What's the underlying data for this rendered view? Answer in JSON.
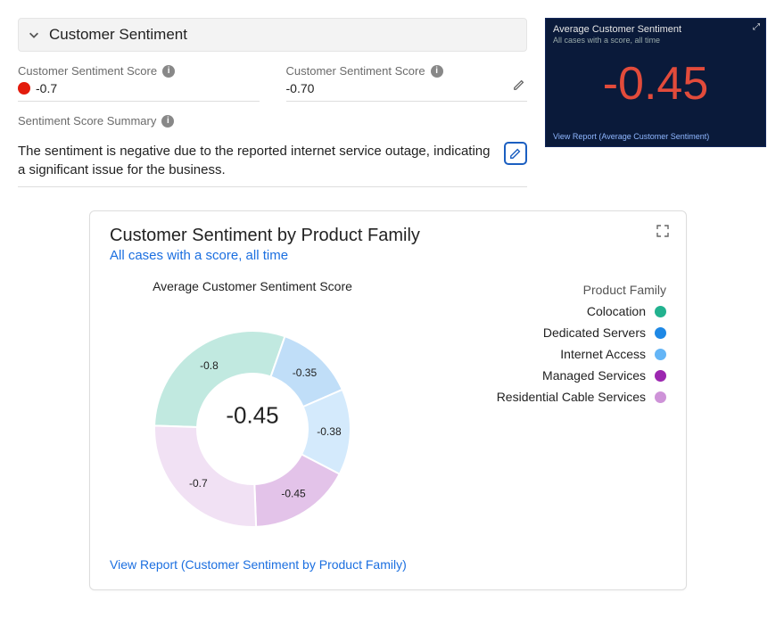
{
  "section": {
    "title": "Customer Sentiment"
  },
  "fields": {
    "score1": {
      "label": "Customer Sentiment Score",
      "value": "-0.7"
    },
    "score2": {
      "label": "Customer Sentiment Score",
      "value": "-0.70"
    },
    "summary_label": "Sentiment Score Summary",
    "summary_text": "The sentiment is negative due to the reported internet service outage, indicating a significant issue for the business."
  },
  "kpi": {
    "title": "Average Customer Sentiment",
    "subtitle": "All cases with a score, all time",
    "value": "-0.45",
    "link": "View Report (Average Customer Sentiment)"
  },
  "chart": {
    "title": "Customer Sentiment by Product Family",
    "subtitle": "All cases with a score, all time",
    "caption": "Average Customer Sentiment Score",
    "center_value": "-0.45",
    "legend_title": "Product Family",
    "link": "View Report (Customer Sentiment by Product Family)",
    "segments": [
      {
        "name": "Colocation",
        "value": "-0.8",
        "color": "#22b28f"
      },
      {
        "name": "Dedicated Servers",
        "value": "-0.35",
        "color": "#1e88e5"
      },
      {
        "name": "Internet Access",
        "value": "-0.38",
        "color": "#64b5f6"
      },
      {
        "name": "Managed Services",
        "value": "-0.45",
        "color": "#9c27b0"
      },
      {
        "name": "Residential Cable Services",
        "value": "-0.7",
        "color": "#ce93d8"
      }
    ]
  },
  "chart_data": {
    "type": "pie",
    "title": "Customer Sentiment by Product Family",
    "subtitle": "Average Customer Sentiment Score",
    "center": -0.45,
    "series": [
      {
        "name": "Colocation",
        "value": -0.8,
        "color": "#22b28f"
      },
      {
        "name": "Dedicated Servers",
        "value": -0.35,
        "color": "#1e88e5"
      },
      {
        "name": "Internet Access",
        "value": -0.38,
        "color": "#64b5f6"
      },
      {
        "name": "Managed Services",
        "value": -0.45,
        "color": "#9c27b0"
      },
      {
        "name": "Residential Cable Services",
        "value": -0.7,
        "color": "#ce93d8"
      }
    ]
  }
}
